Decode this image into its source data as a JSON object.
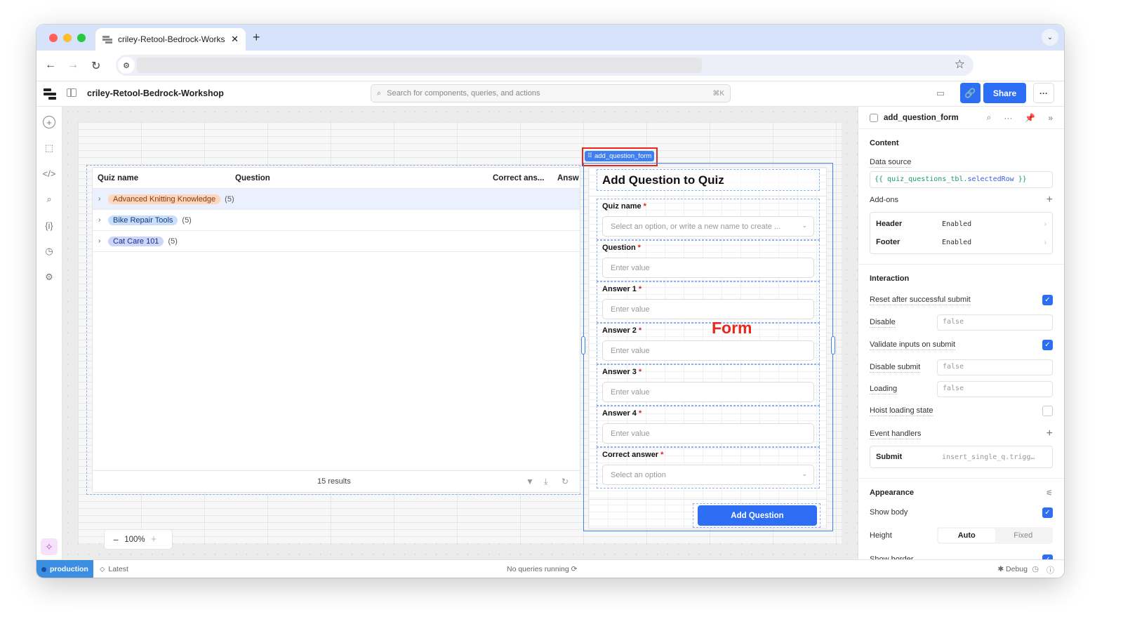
{
  "browser": {
    "tab_title": "criley-Retool-Bedrock-Workshop",
    "new_tab": "+",
    "traffic_lights": {
      "close": "#ff5f57",
      "minimize": "#febc2e",
      "maximize": "#28c840"
    }
  },
  "app": {
    "title": "criley-Retool-Bedrock-Workshop",
    "search_placeholder": "Search for components, queries, and actions",
    "search_shortcut": "⌘K",
    "share_label": "Share",
    "accent": "#2d6ef5"
  },
  "left_rail": {
    "icons": [
      "add-component-icon",
      "select-cursor-icon",
      "code-icon",
      "search-icon",
      "state-icon",
      "history-icon",
      "settings-icon"
    ]
  },
  "table": {
    "columns": [
      "Quiz name",
      "Question",
      "Correct ans...",
      "Answ"
    ],
    "groups": [
      {
        "name": "Advanced Knitting Knowledge",
        "count": "(5)",
        "bg": "#fcd6bd",
        "fg": "#8a3a0a"
      },
      {
        "name": "Bike Repair Tools",
        "count": "(5)",
        "bg": "#c9defc",
        "fg": "#153a7a"
      },
      {
        "name": "Cat Care 101",
        "count": "(5)",
        "bg": "#ccd6fb",
        "fg": "#1a2f8a"
      }
    ],
    "results": "15 results"
  },
  "form": {
    "tag": "add_question_form",
    "title": "Add Question to Quiz",
    "annotation": "Form",
    "fields": [
      {
        "label": "Quiz name",
        "placeholder": "Select an option, or write a new name to create ...",
        "type": "select"
      },
      {
        "label": "Question",
        "placeholder": "Enter value",
        "type": "text"
      },
      {
        "label": "Answer 1",
        "placeholder": "Enter value",
        "type": "text"
      },
      {
        "label": "Answer 2",
        "placeholder": "Enter value",
        "type": "text"
      },
      {
        "label": "Answer 3",
        "placeholder": "Enter value",
        "type": "text"
      },
      {
        "label": "Answer 4",
        "placeholder": "Enter value",
        "type": "text"
      },
      {
        "label": "Correct answer",
        "placeholder": "Select an option",
        "type": "select"
      }
    ],
    "required_mark": "*",
    "submit_label": "Add Question"
  },
  "zoom": {
    "level": "100%"
  },
  "inspector": {
    "component": "add_question_form",
    "content": {
      "title": "Content",
      "data_source_label": "Data source",
      "data_source_open": "{{ quiz_questions_tbl.",
      "data_source_key": "selectedRow",
      "data_source_close": " }}",
      "addons_label": "Add-ons",
      "addons": [
        {
          "name": "Header",
          "value": "Enabled"
        },
        {
          "name": "Footer",
          "value": "Enabled"
        }
      ]
    },
    "interaction": {
      "title": "Interaction",
      "reset_label": "Reset after successful submit",
      "reset_checked": true,
      "disable_label": "Disable",
      "disable_value": "false",
      "validate_label": "Validate inputs on submit",
      "validate_checked": true,
      "disable_submit_label": "Disable submit",
      "disable_submit_value": "false",
      "loading_label": "Loading",
      "loading_value": "false",
      "hoist_label": "Hoist loading state",
      "hoist_checked": false,
      "event_handlers_label": "Event handlers",
      "event": {
        "name": "Submit",
        "action": "insert_single_q.trigg…"
      }
    },
    "appearance": {
      "title": "Appearance",
      "show_body_label": "Show body",
      "show_body_checked": true,
      "height_label": "Height",
      "height_options": [
        "Auto",
        "Fixed"
      ],
      "height_selected": "Auto",
      "show_border_label": "Show border",
      "show_border_checked": true
    }
  },
  "status": {
    "env": "production",
    "version": "Latest",
    "queries": "No queries running",
    "debug": "Debug"
  }
}
